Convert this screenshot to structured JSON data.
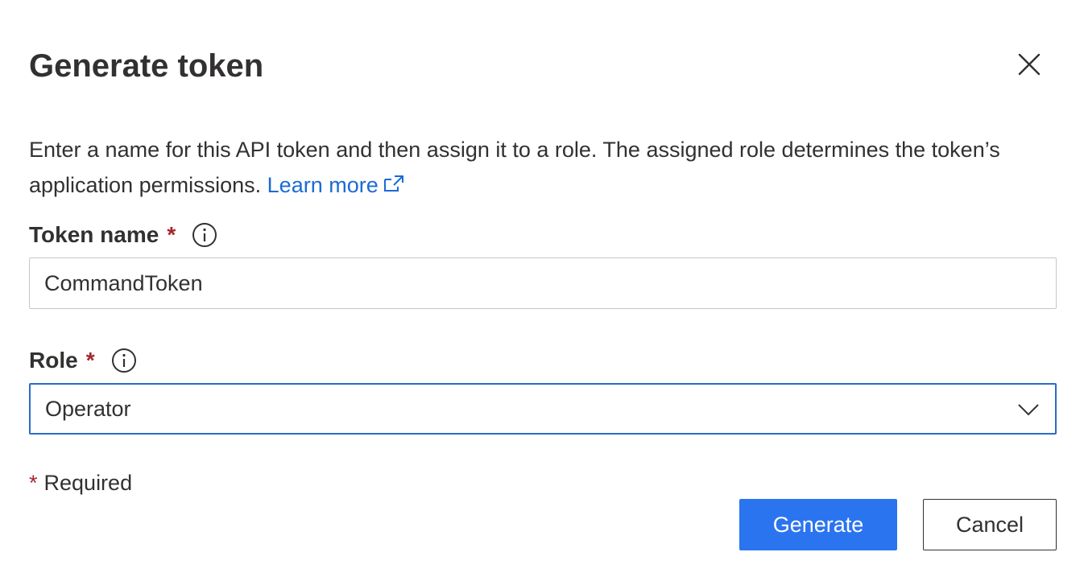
{
  "dialog": {
    "title": "Generate token",
    "description": "Enter a name for this API token and then assign it to a role. The assigned role determines the token’s application permissions.",
    "learn_more": "Learn more"
  },
  "token_name": {
    "label": "Token name",
    "required_marker": "*",
    "value": "CommandToken"
  },
  "role": {
    "label": "Role",
    "required_marker": "*",
    "selected": "Operator"
  },
  "footer": {
    "required_marker": "*",
    "required_note": "Required",
    "generate_label": "Generate",
    "cancel_label": "Cancel"
  },
  "colors": {
    "accent": "#2b74f0",
    "link": "#1a6bd6",
    "required": "#a4262c",
    "focus_border": "#2b6bc4"
  },
  "icons": {
    "close": "close-icon",
    "external_link": "external-link-icon",
    "info": "info-icon",
    "dropdown": "chevron-down-icon"
  }
}
